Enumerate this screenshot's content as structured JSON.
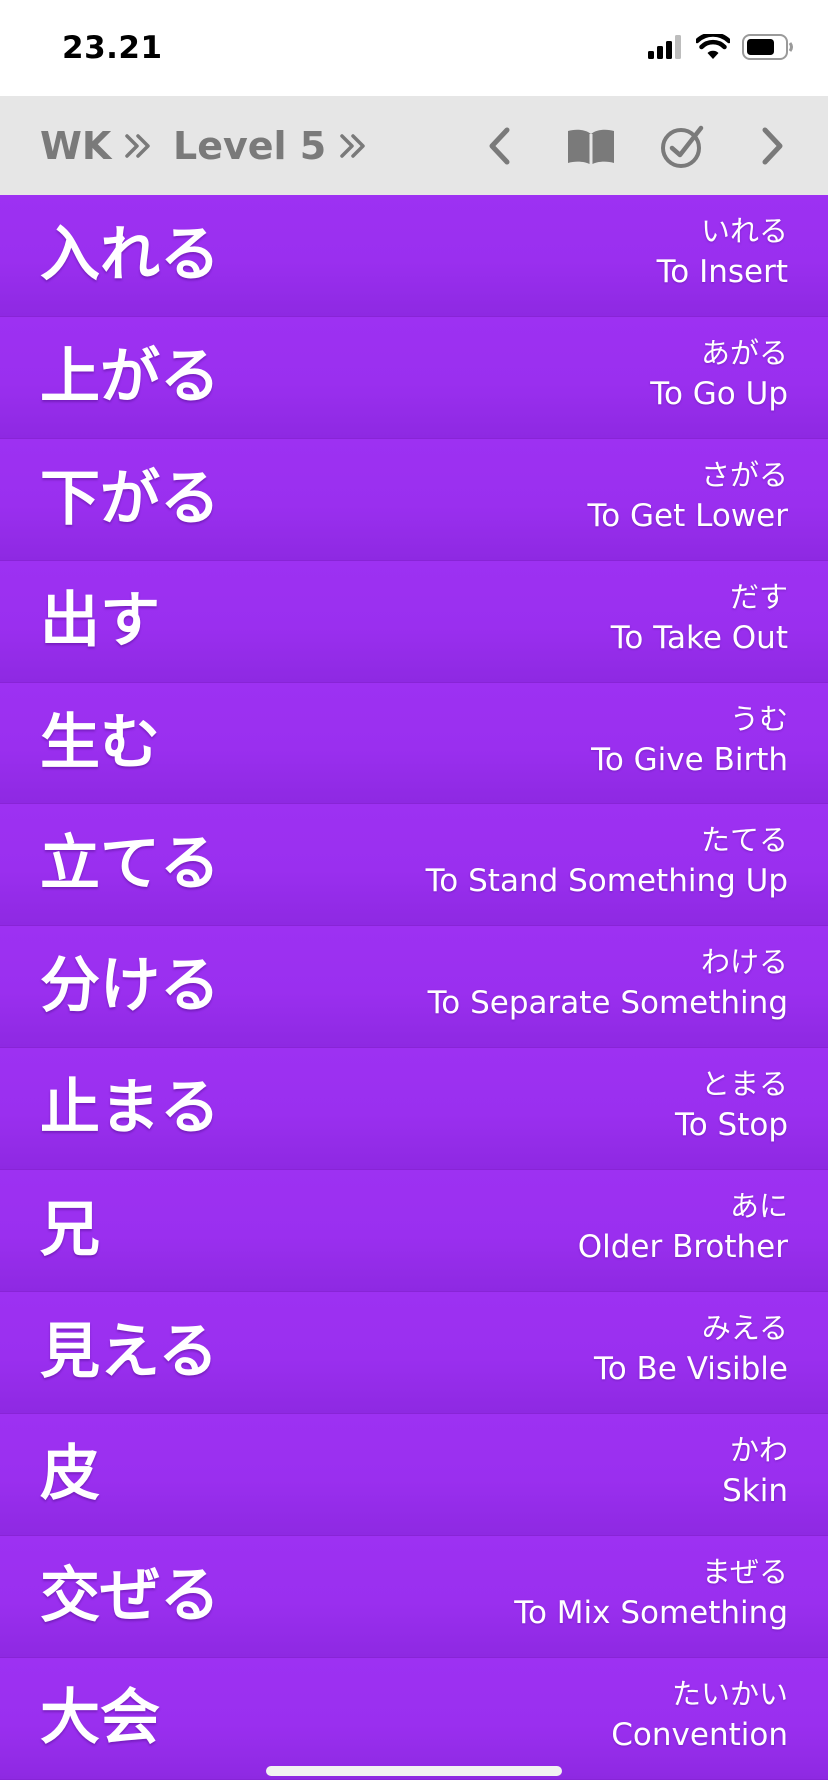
{
  "status": {
    "time": "23.21"
  },
  "nav": {
    "breadcrumb_root": "WK",
    "breadcrumb_level": "Level 5"
  },
  "colors": {
    "row_background": "#9d31f2",
    "nav_background": "#e6e6e6",
    "nav_text": "#7a7a7a"
  },
  "items": [
    {
      "kanji": "入れる",
      "reading": "いれる",
      "meaning": "To Insert"
    },
    {
      "kanji": "上がる",
      "reading": "あがる",
      "meaning": "To Go Up"
    },
    {
      "kanji": "下がる",
      "reading": "さがる",
      "meaning": "To Get Lower"
    },
    {
      "kanji": "出す",
      "reading": "だす",
      "meaning": "To Take Out"
    },
    {
      "kanji": "生む",
      "reading": "うむ",
      "meaning": "To Give Birth"
    },
    {
      "kanji": "立てる",
      "reading": "たてる",
      "meaning": "To Stand Something Up"
    },
    {
      "kanji": "分ける",
      "reading": "わける",
      "meaning": "To Separate Something"
    },
    {
      "kanji": "止まる",
      "reading": "とまる",
      "meaning": "To Stop"
    },
    {
      "kanji": "兄",
      "reading": "あに",
      "meaning": "Older Brother"
    },
    {
      "kanji": "見える",
      "reading": "みえる",
      "meaning": "To Be Visible"
    },
    {
      "kanji": "皮",
      "reading": "かわ",
      "meaning": "Skin"
    },
    {
      "kanji": "交ぜる",
      "reading": "まぜる",
      "meaning": "To Mix Something"
    },
    {
      "kanji": "大会",
      "reading": "たいかい",
      "meaning": "Convention"
    }
  ]
}
